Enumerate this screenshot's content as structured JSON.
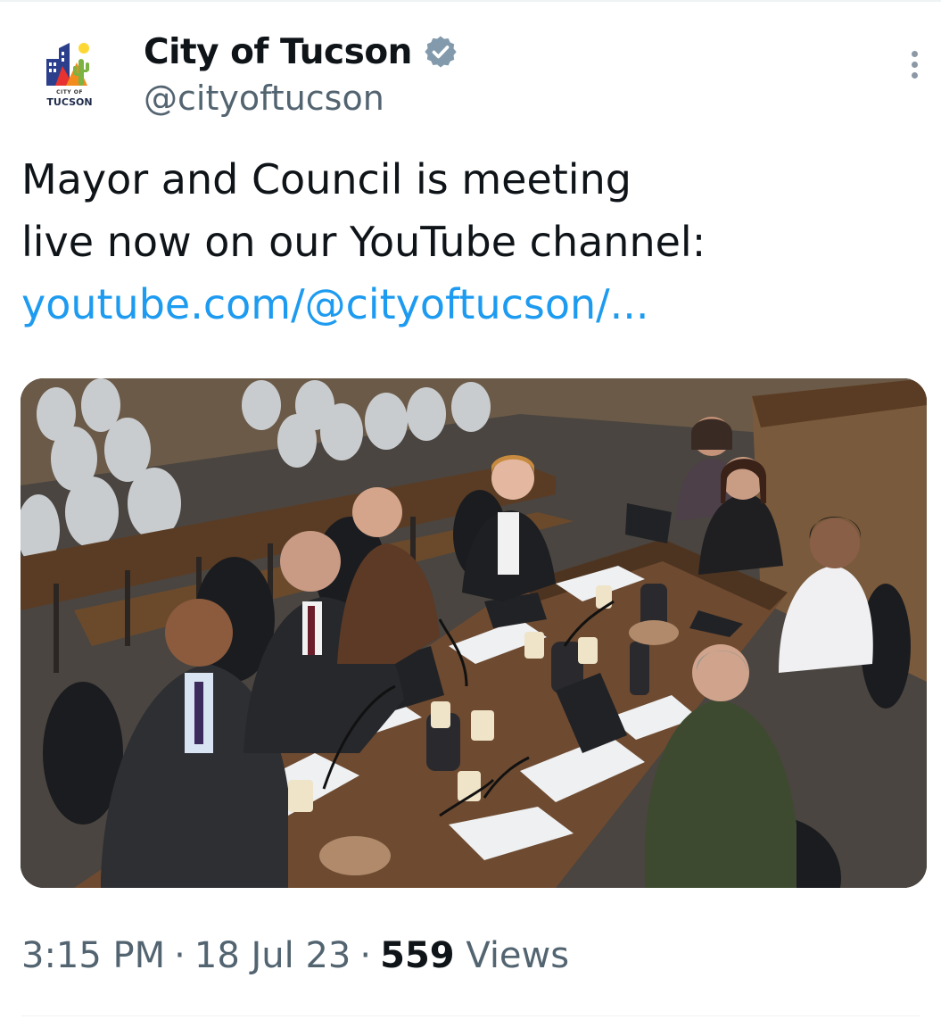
{
  "tweet": {
    "author": {
      "display_name": "City of Tucson",
      "handle": "@cityoftucson",
      "verified": true,
      "avatar": {
        "icon": "city-of-tucson-logo",
        "text_small": "CITY OF",
        "text_large": "TUCSON"
      }
    },
    "more_icon": "more-vertical-icon",
    "text_line1": "Mayor and Council is meeting",
    "text_line2": "live now on our YouTube channel:",
    "link_text": "youtube.com/@cityoftucson/...",
    "media": {
      "type": "photo",
      "subject": "council-meeting-photo"
    },
    "meta": {
      "time": "3:15 PM",
      "separator": "·",
      "date": "18 Jul 23",
      "views_count": "559",
      "views_label": "Views"
    }
  },
  "colors": {
    "link": "#1d9bf0",
    "verified_badge": "#829aab",
    "secondary_text": "#536471",
    "primary_text": "#0f1419"
  }
}
